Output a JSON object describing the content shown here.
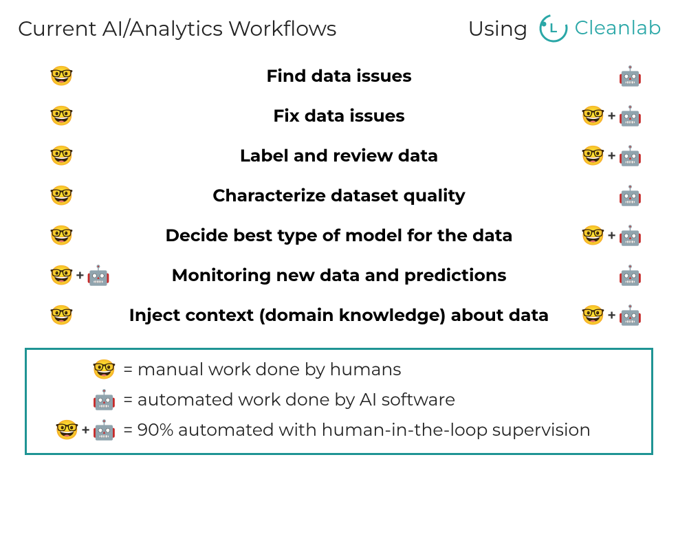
{
  "header": {
    "left": "Current AI/Analytics Workflows",
    "using": "Using",
    "brand": "Cleanlab"
  },
  "rows": [
    {
      "left": "nerd",
      "label": "Find data issues",
      "right": "robot"
    },
    {
      "left": "nerd",
      "label": "Fix data issues",
      "right": "combo"
    },
    {
      "left": "nerd",
      "label": "Label and review data",
      "right": "combo"
    },
    {
      "left": "nerd",
      "label": "Characterize dataset quality",
      "right": "robot"
    },
    {
      "left": "nerd",
      "label": "Decide best type of model for the data",
      "right": "combo"
    },
    {
      "left": "combo",
      "label": "Monitoring new data and predictions",
      "right": "robot"
    },
    {
      "left": "nerd",
      "label": "Inject context (domain knowledge) about data",
      "right": "combo"
    }
  ],
  "legend": {
    "nerd": "= manual work done by humans",
    "robot": "= automated work done by AI software",
    "combo": "= 90% automated with human-in-the-loop supervision"
  },
  "glyphs": {
    "nerd": "🤓",
    "robot": "🤖",
    "plus": "+"
  }
}
